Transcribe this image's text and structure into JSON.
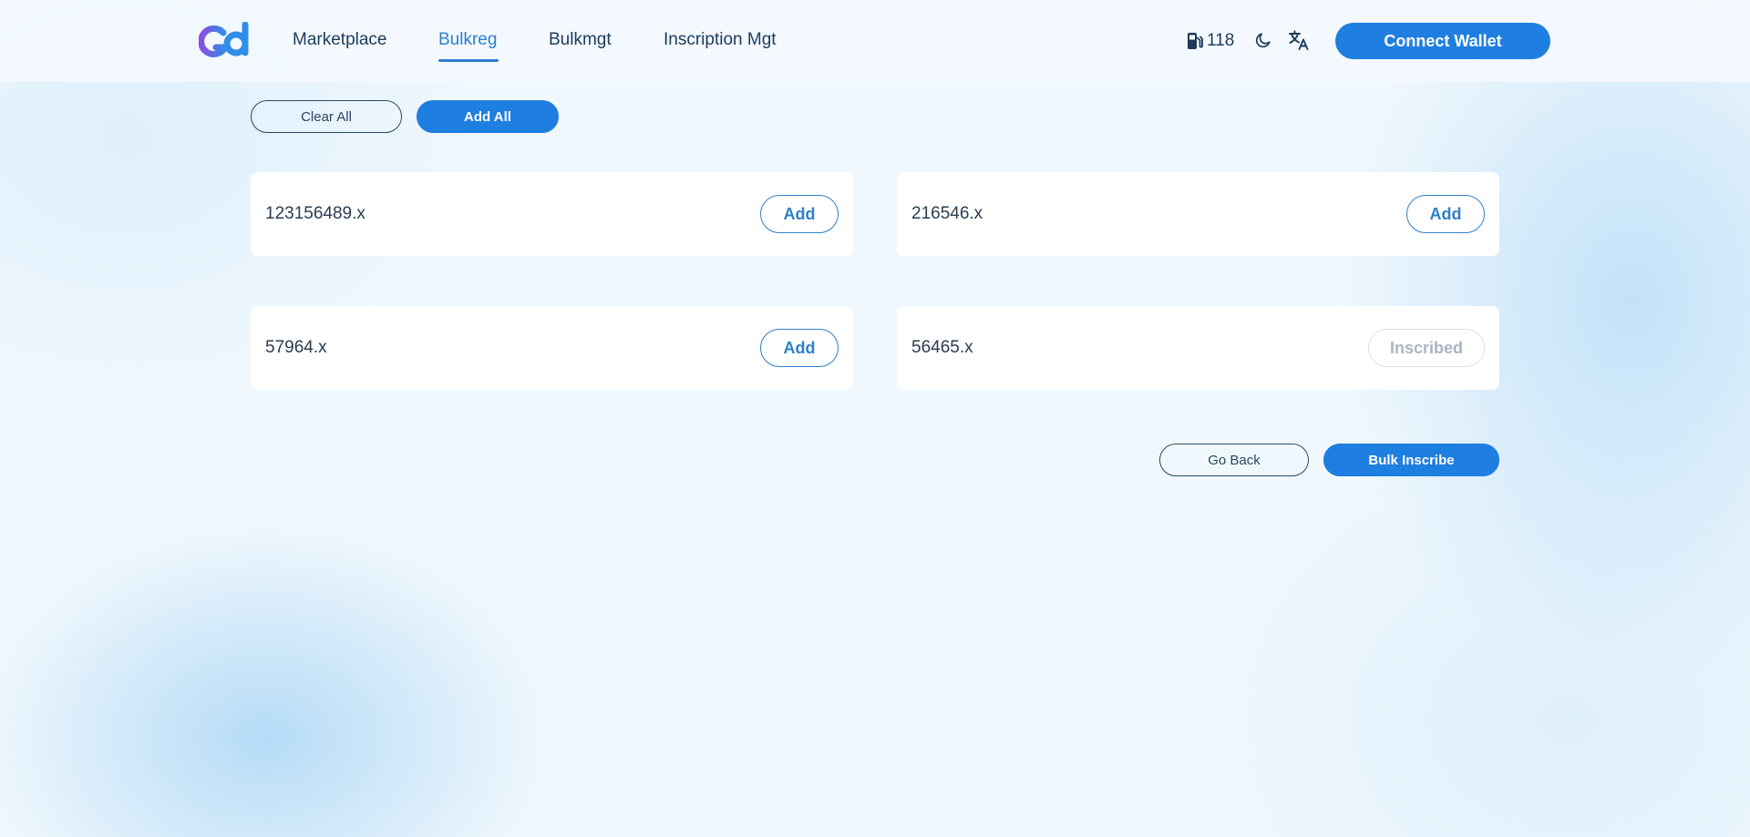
{
  "header": {
    "nav": [
      {
        "label": "Marketplace",
        "active": false
      },
      {
        "label": "Bulkreg",
        "active": true
      },
      {
        "label": "Bulkmgt",
        "active": false
      },
      {
        "label": "Inscription Mgt",
        "active": false
      }
    ],
    "gas_value": "118",
    "connect_label": "Connect Wallet"
  },
  "actions": {
    "clear_all": "Clear All",
    "add_all": "Add All"
  },
  "items": [
    {
      "name": "123156489.x",
      "button": "Add",
      "state": "add"
    },
    {
      "name": "216546.x",
      "button": "Add",
      "state": "add"
    },
    {
      "name": "57964.x",
      "button": "Add",
      "state": "add"
    },
    {
      "name": "56465.x",
      "button": "Inscribed",
      "state": "inscribed"
    }
  ],
  "footer": {
    "go_back": "Go Back",
    "bulk_inscribe": "Bulk Inscribe"
  },
  "colors": {
    "accent": "#1e7fe0",
    "nav_active": "#2e7fd0",
    "text_dark": "#1d3b5d",
    "inscribed_text": "#a9b6c2"
  },
  "icons": [
    "gas-pump-icon",
    "moon-icon",
    "translate-icon"
  ]
}
